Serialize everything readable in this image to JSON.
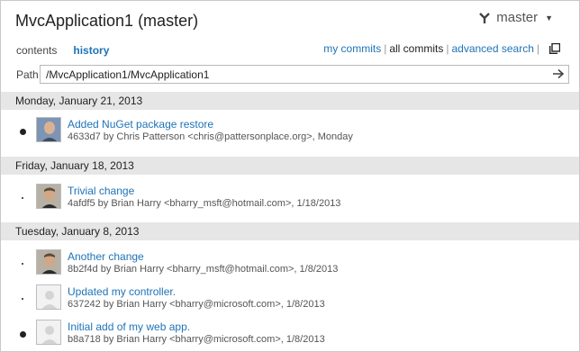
{
  "header": {
    "repo_title": "MvcApplication1 (master)",
    "branch": "master"
  },
  "tabs": [
    {
      "label": "contents"
    },
    {
      "label": "history"
    }
  ],
  "links": {
    "my_commits": "my commits",
    "all_commits": "all commits",
    "advanced_search": "advanced search",
    "separator": "|"
  },
  "path": {
    "label": "Path",
    "value": "/MvcApplication1/MvcApplication1"
  },
  "groups": [
    {
      "date": "Monday, January 21, 2013",
      "commits": [
        {
          "message": "Added NuGet package restore",
          "meta": "4633d7 by Chris Patterson <chris@pattersonplace.org>, Monday",
          "avatar": "photo-chris"
        }
      ]
    },
    {
      "date": "Friday, January 18, 2013",
      "commits": [
        {
          "message": "Trivial change",
          "meta": "4afdf5 by Brian Harry <bharry_msft@hotmail.com>, 1/18/2013",
          "avatar": "photo-brian"
        }
      ]
    },
    {
      "date": "Tuesday, January 8, 2013",
      "commits": [
        {
          "message": "Another change",
          "meta": "8b2f4d by Brian Harry <bharry_msft@hotmail.com>, 1/8/2013",
          "avatar": "photo-brian"
        },
        {
          "message": "Updated my controller.",
          "meta": "637242 by Brian Harry <bharry@microsoft.com>, 1/8/2013",
          "avatar": "placeholder-person"
        },
        {
          "message": "Initial add of my web app.",
          "meta": "b8a718 by Brian Harry <bharry@microsoft.com>, 1/8/2013",
          "avatar": "placeholder-person"
        }
      ]
    }
  ],
  "colors": {
    "link": "#1e73b8",
    "group_header_bg": "#e6e6e6"
  }
}
